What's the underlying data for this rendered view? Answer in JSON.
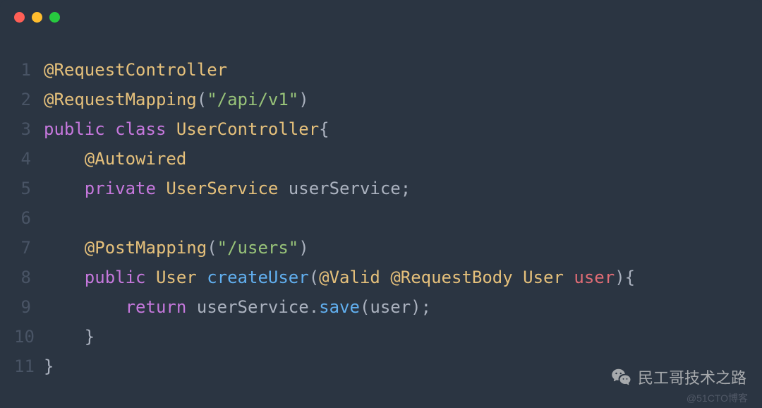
{
  "code": {
    "lines": [
      {
        "num": "1",
        "tokens": [
          {
            "t": "@RequestController",
            "c": "annotation"
          }
        ]
      },
      {
        "num": "2",
        "tokens": [
          {
            "t": "@RequestMapping",
            "c": "annotation"
          },
          {
            "t": "(",
            "c": "punct"
          },
          {
            "t": "\"/api/v1\"",
            "c": "string"
          },
          {
            "t": ")",
            "c": "punct"
          }
        ]
      },
      {
        "num": "3",
        "tokens": [
          {
            "t": "public",
            "c": "keyword"
          },
          {
            "t": " ",
            "c": "punct"
          },
          {
            "t": "class",
            "c": "keyword"
          },
          {
            "t": " ",
            "c": "punct"
          },
          {
            "t": "UserController",
            "c": "type"
          },
          {
            "t": "{",
            "c": "punct"
          }
        ]
      },
      {
        "num": "4",
        "tokens": [
          {
            "t": "    ",
            "c": "punct"
          },
          {
            "t": "@Autowired",
            "c": "annotation"
          }
        ]
      },
      {
        "num": "5",
        "tokens": [
          {
            "t": "    ",
            "c": "punct"
          },
          {
            "t": "private",
            "c": "keyword"
          },
          {
            "t": " ",
            "c": "punct"
          },
          {
            "t": "UserService",
            "c": "type"
          },
          {
            "t": " userService;",
            "c": "punct"
          }
        ]
      },
      {
        "num": "6",
        "tokens": []
      },
      {
        "num": "7",
        "tokens": [
          {
            "t": "    ",
            "c": "punct"
          },
          {
            "t": "@PostMapping",
            "c": "annotation"
          },
          {
            "t": "(",
            "c": "punct"
          },
          {
            "t": "\"/users\"",
            "c": "string"
          },
          {
            "t": ")",
            "c": "punct"
          }
        ]
      },
      {
        "num": "8",
        "tokens": [
          {
            "t": "    ",
            "c": "punct"
          },
          {
            "t": "public",
            "c": "keyword"
          },
          {
            "t": " ",
            "c": "punct"
          },
          {
            "t": "User",
            "c": "type"
          },
          {
            "t": " ",
            "c": "punct"
          },
          {
            "t": "createUser",
            "c": "method"
          },
          {
            "t": "(",
            "c": "punct"
          },
          {
            "t": "@Valid",
            "c": "annotation"
          },
          {
            "t": " ",
            "c": "punct"
          },
          {
            "t": "@RequestBody",
            "c": "annotation"
          },
          {
            "t": " ",
            "c": "punct"
          },
          {
            "t": "User",
            "c": "type"
          },
          {
            "t": " ",
            "c": "punct"
          },
          {
            "t": "user",
            "c": "identifier"
          },
          {
            "t": "){",
            "c": "punct"
          }
        ]
      },
      {
        "num": "9",
        "tokens": [
          {
            "t": "        ",
            "c": "punct"
          },
          {
            "t": "return",
            "c": "keyword"
          },
          {
            "t": " userService.",
            "c": "punct"
          },
          {
            "t": "save",
            "c": "method"
          },
          {
            "t": "(user);",
            "c": "punct"
          }
        ]
      },
      {
        "num": "10",
        "tokens": [
          {
            "t": "    }",
            "c": "punct"
          }
        ]
      },
      {
        "num": "11",
        "tokens": [
          {
            "t": "}",
            "c": "punct"
          }
        ]
      }
    ]
  },
  "watermark": {
    "wechat_text": "民工哥技术之路",
    "cto_text": "@51CTO博客"
  }
}
